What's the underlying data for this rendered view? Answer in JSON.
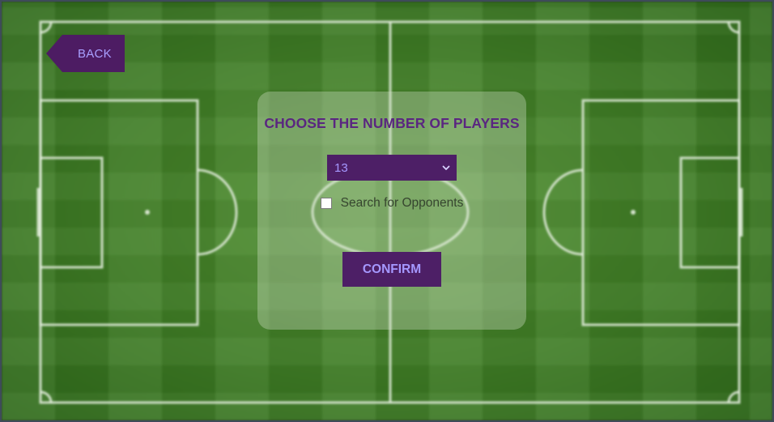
{
  "back_button": {
    "label": "BACK"
  },
  "panel": {
    "title": "CHOOSE THE NUMBER OF PLAYERS",
    "player_count_select": {
      "selected": "13",
      "icon": "chevron-down-icon"
    },
    "search_opponents": {
      "label": "Search for Opponents",
      "checked": false
    },
    "confirm_label": "CONFIRM"
  },
  "colors": {
    "button_bg": "#4d1c63",
    "button_text": "#a598ff",
    "title_text": "#5a2680",
    "field_green": "#3f7d25",
    "field_lines": "#e6f0e0"
  }
}
